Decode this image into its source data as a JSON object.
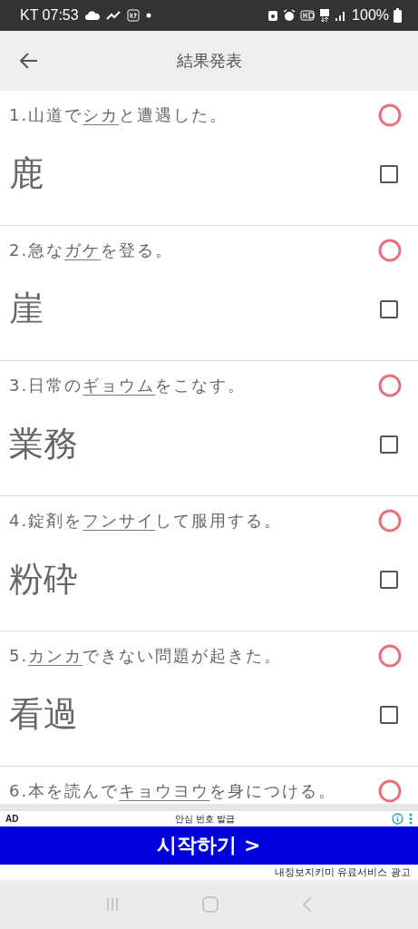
{
  "status_bar": {
    "carrier_time": "KT 07:53",
    "battery": "100%"
  },
  "app_bar": {
    "title": "結果発表"
  },
  "questions": [
    {
      "number": "1.",
      "before": "山道で",
      "underlined": "シカ",
      "after": "と遭遇した。",
      "correct": true,
      "answer": "鹿",
      "checked": false
    },
    {
      "number": "2.",
      "before": "急な",
      "underlined": "ガケ",
      "after": "を登る。",
      "correct": true,
      "answer": "崖",
      "checked": false
    },
    {
      "number": "3.",
      "before": "日常の",
      "underlined": "ギョウム",
      "after": "をこなす。",
      "correct": true,
      "answer": "業務",
      "checked": false
    },
    {
      "number": "4.",
      "before": "錠剤を",
      "underlined": "フンサイ",
      "after": "して服用する。",
      "correct": true,
      "answer": "粉砕",
      "checked": false
    },
    {
      "number": "5.",
      "underlined": "カンカ",
      "after": "できない問題が起きた。",
      "correct": true,
      "answer": "看過",
      "checked": false
    },
    {
      "number": "6.",
      "before": "本を読んで",
      "underlined": "キョウヨウ",
      "after": "を身につける。",
      "correct": true
    }
  ],
  "ad": {
    "label": "AD",
    "headline": "안심 번호 발급",
    "cta": "시작하기 >",
    "footer": "내정보지키미 유료서비스 광고"
  }
}
